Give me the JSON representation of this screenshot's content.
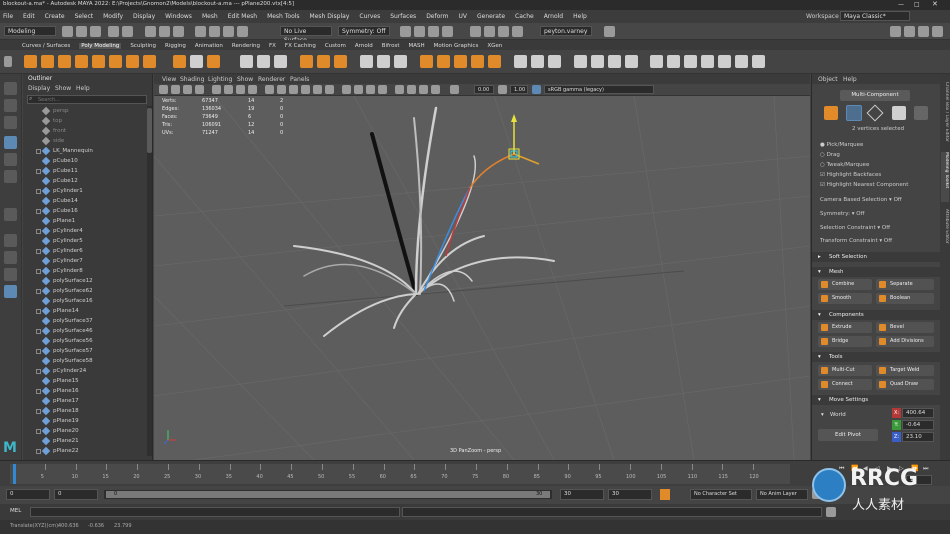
{
  "title_bar": {
    "title": "blockout-a.ma* - Autodesk MAYA 2022: E:\\Projects\\Gnomon2\\Models\\blockout-a.ma --- pPlane200.vtx[4:5]"
  },
  "menu_bar": {
    "items": [
      "File",
      "Edit",
      "Create",
      "Select",
      "Modify",
      "Display",
      "Windows",
      "Mesh",
      "Edit Mesh",
      "Mesh Tools",
      "Mesh Display",
      "Curves",
      "Surfaces",
      "Deform",
      "UV",
      "Generate",
      "Cache",
      "Arnold",
      "Help"
    ],
    "workspace_label": "Workspace :",
    "workspace_value": "Maya Classic*"
  },
  "status_line": {
    "mode": "Modeling",
    "live_surface": "No Live Surface",
    "symmetry": "Symmetry: Off",
    "user": "peyton.varney"
  },
  "shelf_tabs": [
    "Curves / Surfaces",
    "Poly Modeling",
    "Sculpting",
    "Rigging",
    "Animation",
    "Rendering",
    "FX",
    "FX Caching",
    "Custom",
    "Arnold",
    "Bifrost",
    "MASH",
    "Motion Graphics",
    "XGen"
  ],
  "outliner": {
    "title": "Outliner",
    "menus": [
      "Display",
      "Show",
      "Help"
    ],
    "search_placeholder": "Search...",
    "items": [
      "persp",
      "top",
      "front",
      "side",
      "LK_Mannequin",
      "pCube10",
      "pCube11",
      "pCube12",
      "pCylinder1",
      "pCube14",
      "pCube16",
      "pPlane1",
      "pCylinder4",
      "pCylinder5",
      "pCylinder6",
      "pCylinder7",
      "pCylinder8",
      "polySurface12",
      "polySurface62",
      "polySurface16",
      "pPlane14",
      "polySurface37",
      "polySurface46",
      "polySurface56",
      "polySurface57",
      "polySurface58",
      "pCylinder24",
      "pPlane15",
      "pPlane16",
      "pPlane17",
      "pPlane18",
      "pPlane19",
      "pPlane20",
      "pPlane21",
      "pPlane22"
    ]
  },
  "viewport": {
    "menus": [
      "View",
      "Shading",
      "Lighting",
      "Show",
      "Renderer",
      "Panels"
    ],
    "gamma_value": "0.00",
    "exposure_value": "1.00",
    "color_space": "sRGB gamma (legacy)",
    "hud": {
      "rows": [
        {
          "label": "Verts:",
          "v1": "67347",
          "v2": "14",
          "v3": "2"
        },
        {
          "label": "Edges:",
          "v1": "136034",
          "v2": "19",
          "v3": "0"
        },
        {
          "label": "Faces:",
          "v1": "73649",
          "v2": "6",
          "v3": "0"
        },
        {
          "label": "Tris:",
          "v1": "106091",
          "v2": "12",
          "v3": "0"
        },
        {
          "label": "UVs:",
          "v1": "71247",
          "v2": "14",
          "v3": "0"
        }
      ]
    },
    "camera_label": "3D PanZoom - persp"
  },
  "modeling_toolkit": {
    "menus": [
      "Object",
      "Help"
    ],
    "mode_button": "Multi-Component",
    "selection_info": "2 vertices selected",
    "options": [
      "Pick/Marquee",
      "Drag",
      "Tweak/Marquee",
      "Highlight Backfaces",
      "Highlight Nearest Component"
    ],
    "camera_based_label": "Camera Based Selection",
    "camera_based_value": "Off",
    "symmetry_label": "Symmetry:",
    "symmetry_value": "Off",
    "selection_constraint_label": "Selection Constraint",
    "selection_constraint_value": "Off",
    "transform_constraint_label": "Transform Constraint",
    "transform_constraint_value": "Off",
    "soft_selection": "Soft Selection",
    "mesh_header": "Mesh",
    "mesh_buttons": [
      "Combine",
      "Separate",
      "Smooth",
      "Boolean"
    ],
    "components_header": "Components",
    "component_buttons": [
      "Extrude",
      "Bevel",
      "Bridge",
      "Add Divisions"
    ],
    "tools_header": "Tools",
    "tool_buttons": [
      "Multi-Cut",
      "Target Weld",
      "Connect",
      "Quad Draw"
    ],
    "move_settings_header": "Move Settings",
    "space": "World",
    "x_label": "X:",
    "x_value": "400.64",
    "y_label": "Y:",
    "y_value": "-0.64",
    "z_label": "Z:",
    "z_value": "23.10",
    "edit_pivot": "Edit Pivot"
  },
  "right_tabs": [
    "Channel Box / Layer Editor",
    "Modeling Toolkit",
    "Attribute Editor"
  ],
  "time_slider": {
    "ticks": [
      "5",
      "10",
      "15",
      "20",
      "25",
      "30",
      "35",
      "40",
      "45",
      "50",
      "55",
      "60",
      "65",
      "70",
      "75",
      "80",
      "85",
      "90",
      "95",
      "100",
      "105",
      "110",
      "115",
      "120"
    ],
    "current_frame": "1"
  },
  "range_slider": {
    "start": "0",
    "inner_start": "0",
    "range_start": "0",
    "range_end": "30",
    "end": "30",
    "outer_end": "30",
    "character_set": "No Character Set",
    "anim_layer": "No Anim Layer"
  },
  "command_line": {
    "lang": "MEL"
  },
  "help_line": {
    "text": "Translate(XYZ)(cm):",
    "x": "400.636",
    "y": "-0.636",
    "z": "23.799"
  },
  "watermark": {
    "brand": "RRCG",
    "sub": "人人素材"
  }
}
